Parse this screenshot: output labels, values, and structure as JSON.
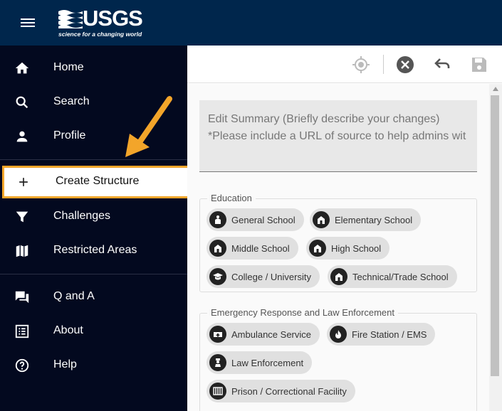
{
  "header": {
    "logo_text": "USGS",
    "logo_tagline": "science for a changing world"
  },
  "sidebar": {
    "items": [
      {
        "label": "Home",
        "icon": "home-icon"
      },
      {
        "label": "Search",
        "icon": "search-icon"
      },
      {
        "label": "Profile",
        "icon": "person-icon"
      },
      {
        "label": "Create Structure",
        "icon": "plus-icon"
      },
      {
        "label": "Challenges",
        "icon": "filter-icon"
      },
      {
        "label": "Restricted Areas",
        "icon": "map-icon"
      },
      {
        "label": "Q and A",
        "icon": "forum-icon"
      },
      {
        "label": "About",
        "icon": "list-icon"
      },
      {
        "label": "Help",
        "icon": "help-icon"
      }
    ]
  },
  "toolbar": {
    "buttons": [
      "locate-icon",
      "close-circle-icon",
      "undo-icon",
      "save-icon"
    ]
  },
  "summary": {
    "placeholder_line1": "Edit Summary (Briefly describe your changes)",
    "placeholder_line2": "*Please include a URL of source to help admins wit"
  },
  "education": {
    "title": "Education",
    "chips": [
      "General School",
      "Elementary School",
      "Middle School",
      "High School",
      "College / University",
      "Technical/Trade School"
    ]
  },
  "emergency": {
    "title": "Emergency Response and Law Enforcement",
    "chips": [
      "Ambulance Service",
      "Fire Station / EMS",
      "Law Enforcement",
      "Prison / Correctional Facility"
    ]
  },
  "colors": {
    "header_bg": "#00264c",
    "sidebar_bg": "#03091f",
    "highlight": "#f3a52a"
  }
}
